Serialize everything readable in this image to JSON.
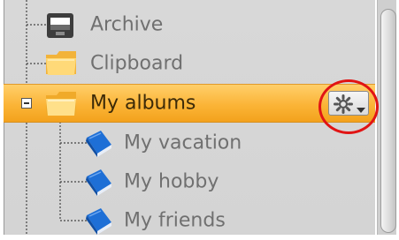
{
  "tree": {
    "items": [
      {
        "label": "Archive",
        "icon": "archive-box-icon"
      },
      {
        "label": "Clipboard",
        "icon": "folder-icon"
      },
      {
        "label": "My albums",
        "icon": "folder-icon",
        "selected": true,
        "expanded": true
      },
      {
        "label": "My vacation",
        "icon": "blue-book-icon"
      },
      {
        "label": "My hobby",
        "icon": "blue-book-icon"
      },
      {
        "label": "My friends",
        "icon": "blue-book-icon"
      }
    ]
  },
  "colors": {
    "selection": "#fbb437",
    "highlight_ring": "#e11414",
    "panel": "#d6d6d6"
  }
}
